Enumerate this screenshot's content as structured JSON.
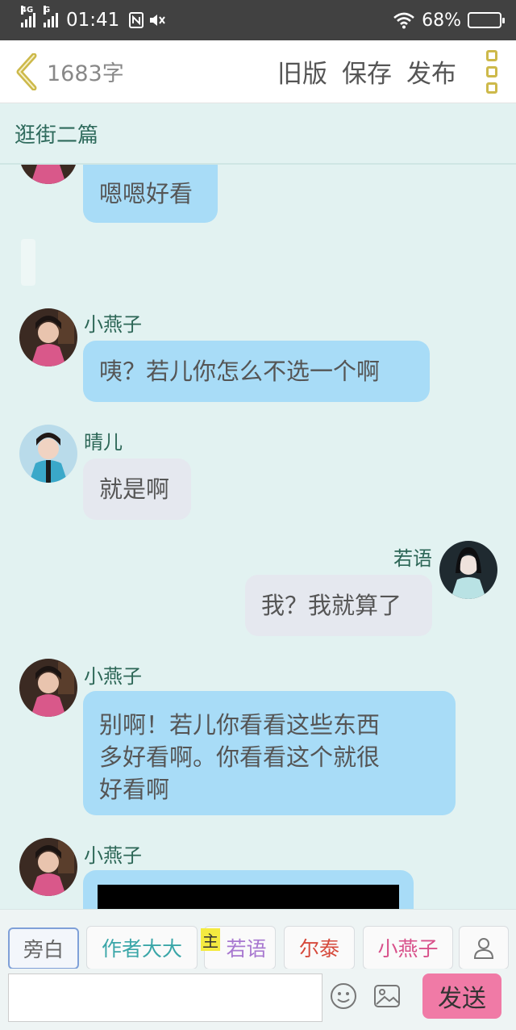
{
  "status_bar": {
    "network_1": "4G",
    "network_2": "G",
    "time": "01:41",
    "battery_percent": "68%",
    "battery_level": 0.68
  },
  "app_bar": {
    "word_count": "1683字",
    "old_version_label": "旧版",
    "save_label": "保存",
    "publish_label": "发布"
  },
  "chapter": {
    "title": "逛街二篇"
  },
  "messages": [
    {
      "speaker": "",
      "text": "嗯嗯好看",
      "style": "blue",
      "side": "left"
    },
    {
      "speaker": "小燕子",
      "text": "咦？若儿你怎么不选一个啊",
      "style": "blue",
      "side": "left"
    },
    {
      "speaker": "晴儿",
      "text": "就是啊",
      "style": "gray",
      "side": "left"
    },
    {
      "speaker": "若语",
      "text": "我？我就算了",
      "style": "gray",
      "side": "right"
    },
    {
      "speaker": "小燕子",
      "lines": [
        "别啊！若儿你看看这些东西",
        "多好看啊。你看看这个就很",
        "好看啊"
      ],
      "style": "blue",
      "side": "left"
    },
    {
      "speaker": "小燕子",
      "text": "",
      "style": "blue",
      "side": "left"
    }
  ],
  "roles": [
    {
      "label": "旁白",
      "color": "#666666",
      "active": true
    },
    {
      "label": "作者大大",
      "color": "#3aa6a8"
    },
    {
      "label": "若语",
      "color": "#a878d0",
      "badge": "主"
    },
    {
      "label": "尔泰",
      "color": "#d64a3c"
    },
    {
      "label": "小燕子",
      "color": "#d8508a"
    }
  ],
  "input_bar": {
    "send_label": "发送",
    "emoji_icon": "emoji-icon",
    "image_icon": "image-icon"
  },
  "colors": {
    "bubble_blue": "#a8dcf7",
    "bubble_gray": "#e5e8ef",
    "background": "#e2f2f1",
    "send_button": "#f07aa6",
    "menu_accent": "#cdb94a"
  }
}
